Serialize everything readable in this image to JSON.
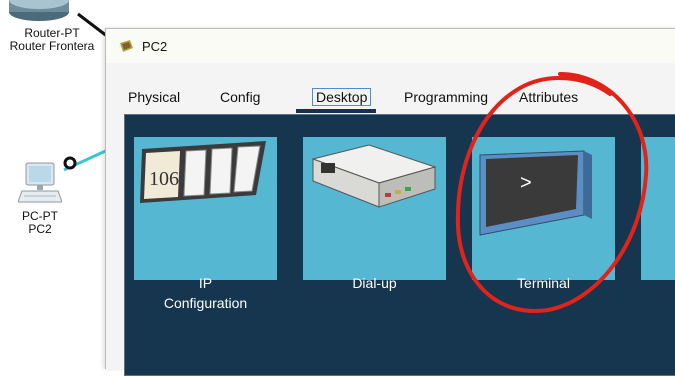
{
  "workspace": {
    "router": {
      "label_line1": "Router-PT",
      "label_line2": "Router Frontera"
    },
    "pc": {
      "label_line1": "PC-PT",
      "label_line2": "PC2"
    }
  },
  "window": {
    "title": "PC2",
    "tabs": [
      {
        "label": "Physical"
      },
      {
        "label": "Config"
      },
      {
        "label": "Desktop",
        "active": true
      },
      {
        "label": "Programming"
      },
      {
        "label": "Attributes"
      }
    ],
    "desktop_apps": [
      {
        "icon": "ip-configuration-icon",
        "label_line1": "IP",
        "label_line2": "Configuration",
        "display_number": "106"
      },
      {
        "icon": "dialup-modem-icon",
        "label_line1": "Dial-up",
        "label_line2": ""
      },
      {
        "icon": "terminal-icon",
        "label_line1": "Terminal",
        "label_line2": "",
        "prompt": ">"
      }
    ]
  },
  "colors": {
    "panel_bg": "#163650",
    "tile_bg": "#56b7d3",
    "annotation": "#e2231a",
    "cable": "#3cc6d6",
    "tab_underline": "#16324f"
  }
}
